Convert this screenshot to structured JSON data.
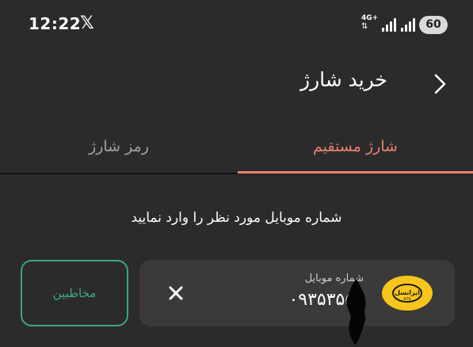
{
  "status_bar": {
    "time": "12:22",
    "app_icon": "x-logo-icon",
    "network_type": "4G+",
    "battery_level": "60"
  },
  "header": {
    "title": "خرید شارژ",
    "back_icon": "chevron-right-icon"
  },
  "tabs": [
    {
      "label": "شارژ مستقیم",
      "active": true
    },
    {
      "label": "رمز شارژ",
      "active": false
    }
  ],
  "instruction": "شماره موبایل مورد نظر را وارد نمایید",
  "phone_input": {
    "label": "شماره موبایل",
    "value": "۰۹۳۵۳۵۵۳",
    "clear_icon": "close-icon",
    "operator_logo_text": "ایرانسل",
    "operator_logo_subtext": "MTN"
  },
  "contacts_button": {
    "label": "مخاطبین"
  },
  "colors": {
    "background": "#2b2b2b",
    "accent": "#e8836d",
    "inactive_tab": "#a3a3a3",
    "card": "#3a3a3a",
    "contacts": "#3aa784",
    "operator": "#f7c51b"
  }
}
